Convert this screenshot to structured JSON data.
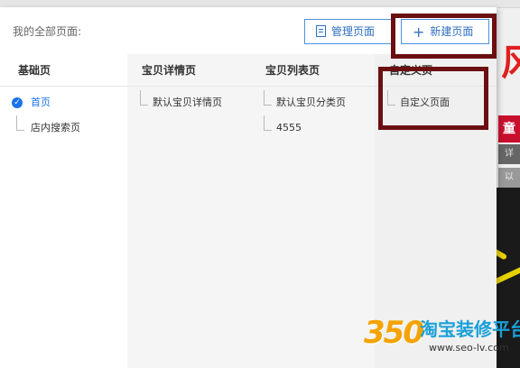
{
  "header": {
    "title": "我的全部页面:",
    "manage_label": "管理页面",
    "new_label": "新建页面"
  },
  "columns": [
    {
      "title": "基础页",
      "items": [
        {
          "label": "首页",
          "selected": true
        },
        {
          "label": "店内搜索页",
          "selected": false
        }
      ]
    },
    {
      "title": "宝贝详情页",
      "items": [
        {
          "label": "默认宝贝详情页"
        }
      ]
    },
    {
      "title": "宝贝列表页",
      "items": [
        {
          "label": "默认宝贝分类页"
        },
        {
          "label": "4555"
        }
      ]
    },
    {
      "title": "自定义页",
      "items": [
        {
          "label": "自定义页面"
        }
      ]
    }
  ],
  "background": {
    "red_char": "风",
    "red_block": "童",
    "grey_block_1": "详",
    "grey_block_2": "以"
  },
  "watermark": {
    "number": "350",
    "name": "淘宝装修平台",
    "url": "www.seo-lv.com"
  },
  "colors": {
    "accent": "#1a73e8",
    "button_border": "#4a90e2",
    "highlight": "#6b0f12"
  }
}
